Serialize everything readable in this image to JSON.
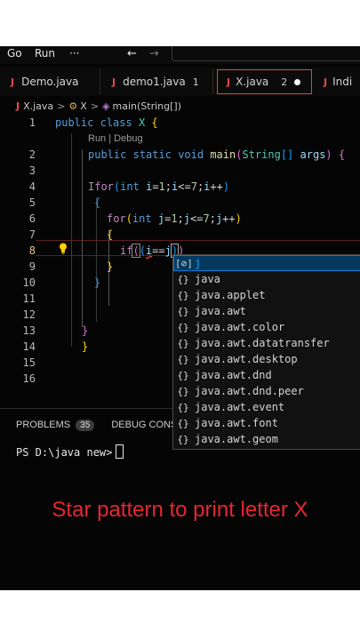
{
  "menu": {
    "go": "Go",
    "run": "Run",
    "more": "···",
    "back": "←",
    "forward": "→"
  },
  "tabs": [
    {
      "icon": "J",
      "label": "Demo.java"
    },
    {
      "icon": "J",
      "label": "demo1.java",
      "count": "1"
    },
    {
      "icon": "J",
      "label": "X.java",
      "count": "2",
      "active": true,
      "dirty": true
    },
    {
      "icon": "J",
      "label": "Indi"
    }
  ],
  "breadcrumb": {
    "file": "X.java",
    "class": "X",
    "method": "main(String[])",
    "sep": ">"
  },
  "codelens": "Run | Debug",
  "lines": [
    "1",
    "2",
    "3",
    "4",
    "5",
    "6",
    "7",
    "8",
    "9",
    "10",
    "11",
    "12",
    "13",
    "14",
    "15",
    "16"
  ],
  "current_line": "8",
  "suggest": {
    "items": [
      {
        "kind": "variable",
        "icon": "[⊘]",
        "label": "j"
      },
      {
        "kind": "module",
        "icon": "{}",
        "label": "java"
      },
      {
        "kind": "module",
        "icon": "{}",
        "label": "java.applet"
      },
      {
        "kind": "module",
        "icon": "{}",
        "label": "java.awt"
      },
      {
        "kind": "module",
        "icon": "{}",
        "label": "java.awt.color"
      },
      {
        "kind": "module",
        "icon": "{}",
        "label": "java.awt.datatransfer"
      },
      {
        "kind": "module",
        "icon": "{}",
        "label": "java.awt.desktop"
      },
      {
        "kind": "module",
        "icon": "{}",
        "label": "java.awt.dnd"
      },
      {
        "kind": "module",
        "icon": "{}",
        "label": "java.awt.dnd.peer"
      },
      {
        "kind": "module",
        "icon": "{}",
        "label": "java.awt.event"
      },
      {
        "kind": "module",
        "icon": "{}",
        "label": "java.awt.font"
      },
      {
        "kind": "module",
        "icon": "{}",
        "label": "java.awt.geom"
      }
    ]
  },
  "panel": {
    "problems_label": "PROBLEMS",
    "problems_count": "35",
    "debug_label": "DEBUG CONSOL",
    "prompt": "PS D:\\java new>"
  },
  "caption": "Star pattern to print letter X",
  "colors": {
    "caption": "#e8262f",
    "tab_active_border": "#e3463e",
    "java_icon": "#e8454d"
  }
}
